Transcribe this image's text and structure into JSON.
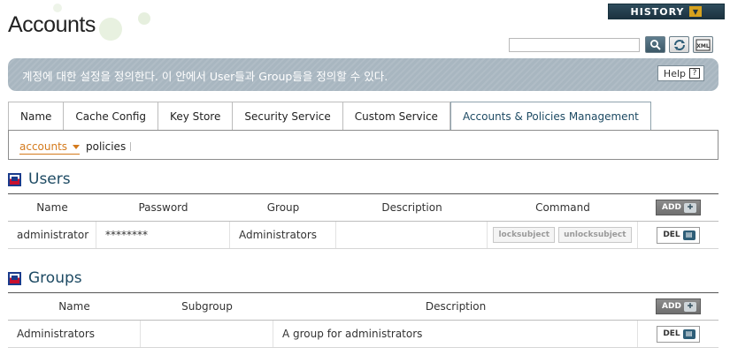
{
  "header": {
    "title": "Accounts",
    "history_label": "HISTORY",
    "search_placeholder": ""
  },
  "banner": {
    "text": "계정에 대한 설정을 정의한다. 이 안에서 User들과 Group들을 정의할 수 있다.",
    "help_label": "Help"
  },
  "tabs": [
    {
      "label": "Name"
    },
    {
      "label": "Cache Config"
    },
    {
      "label": "Key Store"
    },
    {
      "label": "Security Service"
    },
    {
      "label": "Custom Service"
    },
    {
      "label": "Accounts & Policies Management",
      "active": true
    }
  ],
  "subtabs": {
    "accounts": "accounts",
    "policies": "policies"
  },
  "users": {
    "title": "Users",
    "columns": [
      "Name",
      "Password",
      "Group",
      "Description",
      "Command"
    ],
    "add_label": "ADD",
    "rows": [
      {
        "name": "administrator",
        "password": "********",
        "group": "Administrators",
        "description": "",
        "commands": [
          "locksubject",
          "unlocksubject"
        ],
        "del_label": "DEL"
      }
    ]
  },
  "groups": {
    "title": "Groups",
    "columns": [
      "Name",
      "Subgroup",
      "Description"
    ],
    "add_label": "ADD",
    "rows": [
      {
        "name": "Administrators",
        "subgroup": "",
        "description": "A group for administrators",
        "del_label": "DEL"
      }
    ]
  },
  "icons": {
    "history": "chevron-down-icon",
    "search": "search-icon",
    "refresh": "refresh-icon",
    "xml": "xml-icon",
    "help": "question-icon",
    "section": "flag-icon",
    "add": "add-icon",
    "del": "delete-icon"
  },
  "colors": {
    "banner": "#a8b6c0",
    "accent_orange": "#d47a1c",
    "heading_blue": "#1d4a63",
    "history_bg": "#2e4c5c"
  }
}
